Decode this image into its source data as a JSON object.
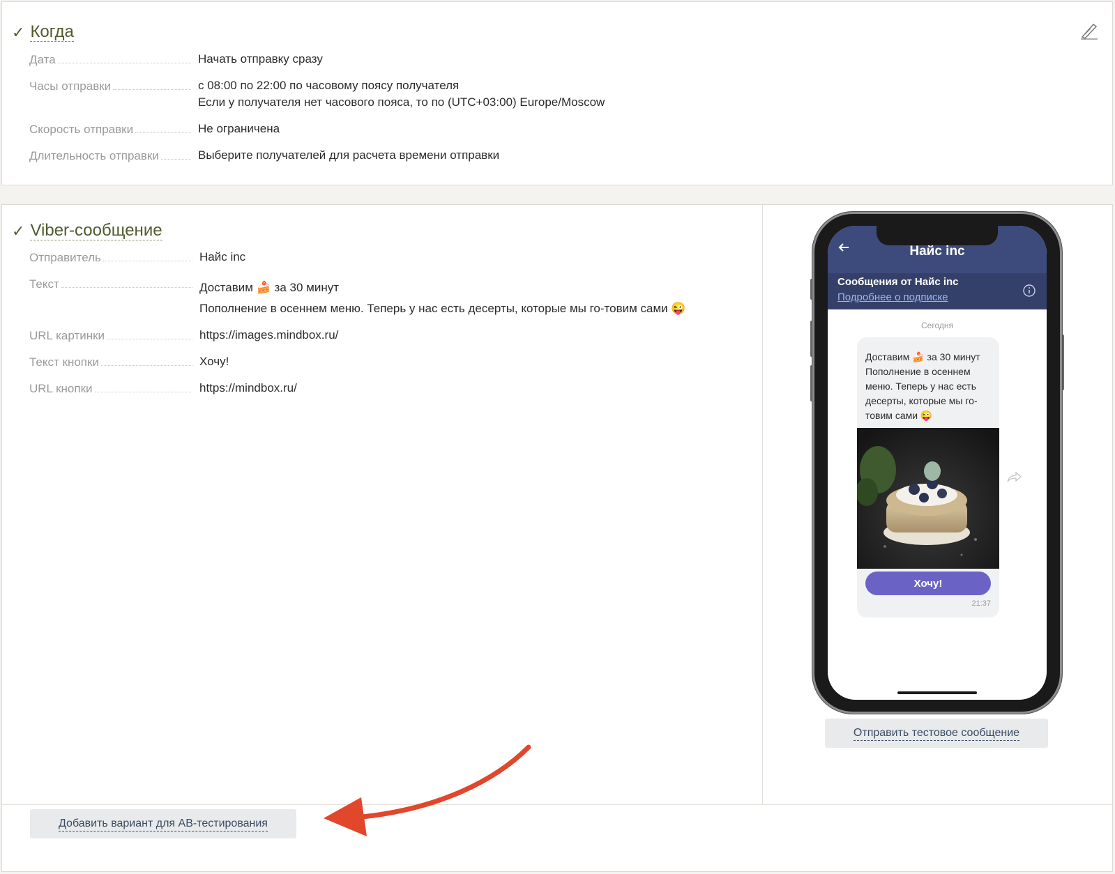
{
  "when": {
    "title": "Когда",
    "fields": [
      {
        "label": "Дата",
        "value": "Начать отправку сразу"
      },
      {
        "label": "Часы отправки",
        "value": "с 08:00 по 22:00 по часовому поясу получателя",
        "value2": "Если у получателя нет часового пояса, то по (UTC+03:00) Europe/Moscow"
      },
      {
        "label": "Скорость отправки",
        "value": "Не ограничена"
      },
      {
        "label": "Длительность отправки",
        "value": "Выберите получателей для расчета времени отправки"
      }
    ]
  },
  "viber": {
    "title": "Viber-сообщение",
    "fields": [
      {
        "label": "Отправитель",
        "value": "Найс inc"
      },
      {
        "label": "Текст",
        "value": "Доставим 🍰 за 30 минут",
        "value2": "Пополнение в осеннем меню. Теперь у нас есть десерты, которые мы го-товим сами 😜"
      },
      {
        "label": "URL картинки",
        "value": "https://images.mindbox.ru/"
      },
      {
        "label": "Текст кнопки",
        "value": "Хочу!"
      },
      {
        "label": "URL кнопки",
        "value": "https://mindbox.ru/"
      }
    ],
    "send_test_label": "Отправить тестовое сообщение",
    "ab_test_label": "Добавить вариант для АВ-тестирования"
  },
  "preview": {
    "header_title": "Найс inc",
    "sub_title": "Сообщения от Найс inc",
    "sub_link": "Подробнее о подписке",
    "day": "Сегодня",
    "bubble_text": "Доставим 🍰 за 30 минут\nПополнение в осеннем меню. Теперь у нас есть десерты, которые мы го-товим сами 😜",
    "button_label": "Хочу!",
    "time": "21:37"
  },
  "icons": {
    "check": "check-icon",
    "edit": "pen-edit-icon",
    "back": "arrow-left-icon",
    "info": "info-icon",
    "share": "share-arrow-icon"
  },
  "colors": {
    "title": "#4f5a2f",
    "viber_header": "#3d4b7c",
    "viber_button": "#6a63c5",
    "annotation_arrow": "#e0472b",
    "link": "#3a4b63"
  }
}
